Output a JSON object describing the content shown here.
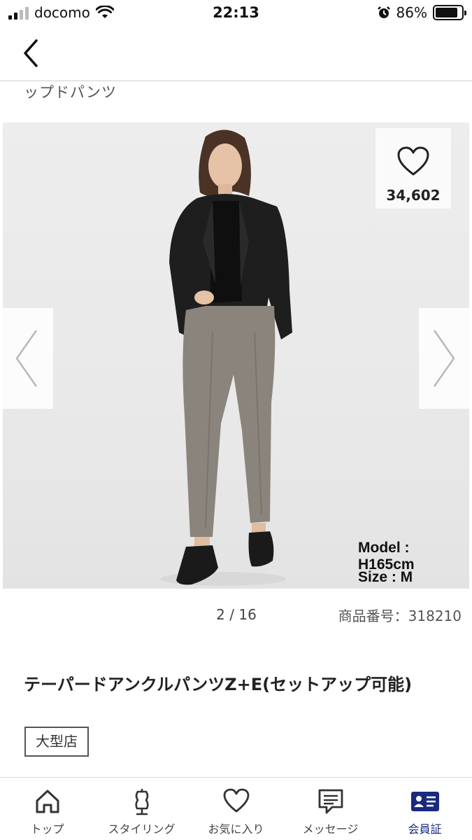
{
  "status_bar": {
    "carrier": "docomo",
    "time": "22:13",
    "battery": "86%",
    "battery_level": 0.86,
    "signal_bars": 2,
    "signal_total": 4
  },
  "breadcrumb": "ップドパンツ",
  "favorite": {
    "icon": "heart-icon",
    "count": "34,602"
  },
  "model_info": {
    "model": "Model : H165cm",
    "size": "Size : M"
  },
  "pager": {
    "indicator": "2 / 16"
  },
  "product": {
    "number": "商品番号：318210",
    "name": "テーパードアンクルパンツZ+E(セットアップ可能)",
    "tag": "大型店"
  },
  "tab_bar": {
    "items": [
      {
        "label": "トップ",
        "icon": "home-icon"
      },
      {
        "label": "スタイリング",
        "icon": "mannequin-icon"
      },
      {
        "label": "お気に入り",
        "icon": "heart-icon"
      },
      {
        "label": "メッセージ",
        "icon": "message-icon"
      },
      {
        "label": "会員証",
        "icon": "member-card-icon"
      }
    ],
    "active_color": "#1a2a80"
  }
}
